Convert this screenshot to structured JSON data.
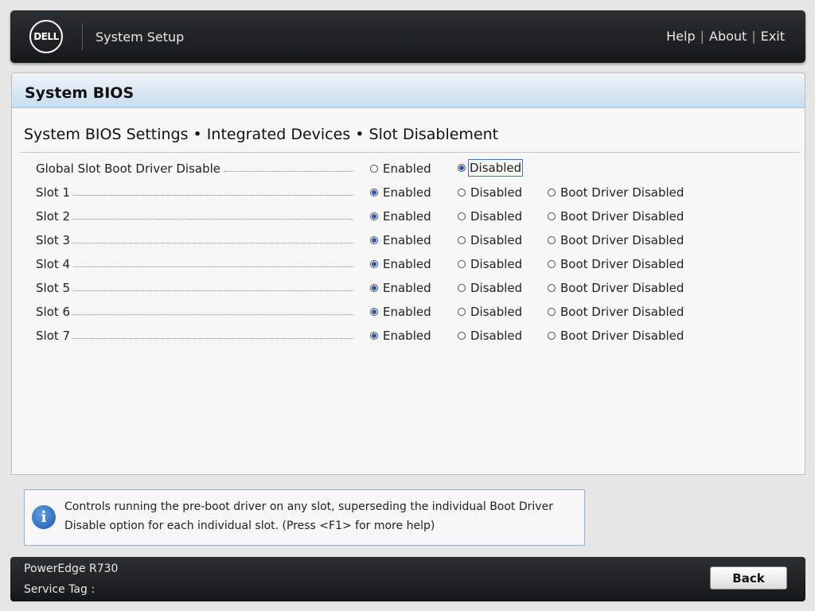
{
  "header": {
    "logo_text": "DELL",
    "app_title": "System Setup",
    "links": [
      "Help",
      "About",
      "Exit"
    ]
  },
  "panel": {
    "title": "System BIOS",
    "breadcrumb": "System BIOS Settings • Integrated Devices • Slot Disablement"
  },
  "settings": [
    {
      "label": "Global Slot Boot Driver Disable",
      "options": [
        "Enabled",
        "Disabled"
      ],
      "selected": "Disabled"
    },
    {
      "label": "Slot 1",
      "options": [
        "Enabled",
        "Disabled",
        "Boot Driver Disabled"
      ],
      "selected": "Enabled"
    },
    {
      "label": "Slot 2",
      "options": [
        "Enabled",
        "Disabled",
        "Boot Driver Disabled"
      ],
      "selected": "Enabled"
    },
    {
      "label": "Slot 3",
      "options": [
        "Enabled",
        "Disabled",
        "Boot Driver Disabled"
      ],
      "selected": "Enabled"
    },
    {
      "label": "Slot 4",
      "options": [
        "Enabled",
        "Disabled",
        "Boot Driver Disabled"
      ],
      "selected": "Enabled"
    },
    {
      "label": "Slot 5",
      "options": [
        "Enabled",
        "Disabled",
        "Boot Driver Disabled"
      ],
      "selected": "Enabled"
    },
    {
      "label": "Slot 6",
      "options": [
        "Enabled",
        "Disabled",
        "Boot Driver Disabled"
      ],
      "selected": "Enabled"
    },
    {
      "label": "Slot 7",
      "options": [
        "Enabled",
        "Disabled",
        "Boot Driver Disabled"
      ],
      "selected": "Enabled"
    }
  ],
  "help": {
    "icon": "info-icon",
    "text": "Controls running the pre-boot driver on any slot, superseding the individual Boot Driver Disable option for each individual slot. (Press <F1> for more help)"
  },
  "footer": {
    "model": "PowerEdge R730",
    "service_tag_label": "Service Tag :",
    "back_label": "Back"
  },
  "colors": {
    "header_bg": "#1f2022",
    "title_gradient": "#c9dcee",
    "radio_selected": "#2a55b8",
    "help_border": "#8fb0cf"
  }
}
